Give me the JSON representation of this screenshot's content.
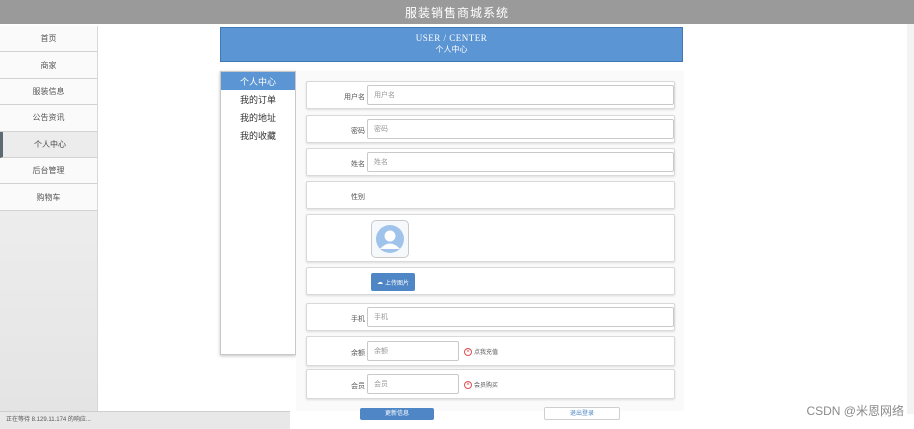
{
  "header": {
    "title": "服装销售商城系统"
  },
  "sidebar": {
    "items": [
      {
        "label": "首页"
      },
      {
        "label": "商家"
      },
      {
        "label": "服装信息"
      },
      {
        "label": "公告资讯"
      },
      {
        "label": "个人中心"
      },
      {
        "label": "后台管理"
      },
      {
        "label": "购物车"
      }
    ]
  },
  "banner": {
    "en": "USER / CENTER",
    "cn": "个人中心"
  },
  "center_menu": {
    "items": [
      {
        "label": "个人中心"
      },
      {
        "label": "我的订单"
      },
      {
        "label": "我的地址"
      },
      {
        "label": "我的收藏"
      }
    ]
  },
  "form": {
    "username": {
      "label": "用户名",
      "placeholder": "用户名"
    },
    "password": {
      "label": "密码",
      "placeholder": "密码"
    },
    "name": {
      "label": "姓名",
      "placeholder": "姓名"
    },
    "gender": {
      "label": "性别"
    },
    "upload_label": "上传图片",
    "phone": {
      "label": "手机",
      "placeholder": "手机"
    },
    "balance": {
      "label": "余额",
      "placeholder": "余额",
      "action": "点我充值"
    },
    "member": {
      "label": "会员",
      "placeholder": "会员",
      "action": "会员购买"
    },
    "save_label": "更新信息",
    "logout_label": "退出登录"
  },
  "status": {
    "text": "正在等待 8.129.11.174 的响应..."
  },
  "watermark": "CSDN @米恩网络",
  "colors": {
    "accent": "#5b95d3",
    "topbar": "#9a9a9a"
  }
}
